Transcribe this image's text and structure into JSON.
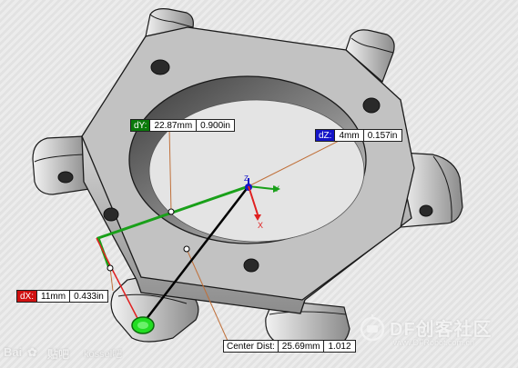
{
  "dimensions": {
    "dy": {
      "tag": "dY:",
      "mm": "22.87mm",
      "inch": "0.900in",
      "color": "#0a7a0a"
    },
    "dz": {
      "tag": "dZ:",
      "mm": "4mm",
      "inch": "0.157in",
      "color": "#1515c8"
    },
    "dx": {
      "tag": "dX:",
      "mm": "11mm",
      "inch": "0.433in",
      "color": "#d01010"
    },
    "center_dist": {
      "tag": "Center Dist:",
      "mm": "25.69mm",
      "inch": "1.012"
    }
  },
  "triad": {
    "y_label": "Y",
    "z_label": "Z",
    "x_label": "X"
  },
  "watermarks": {
    "right_title": "DF创客社区",
    "right_url": "www.DFRobot.com.cn",
    "left_brand": "Bai",
    "left_tieba": "贴吧",
    "left_user": "kossel吧"
  },
  "colors": {
    "part_light": "#c8c8c8",
    "part_top": "#b9b9b9",
    "part_dark": "#5a5a5a",
    "edge": "#1a1a1a",
    "measure_green": "#19a019",
    "measure_red": "#e02020",
    "measure_black": "#000000",
    "leader_orange": "#c0703a"
  }
}
